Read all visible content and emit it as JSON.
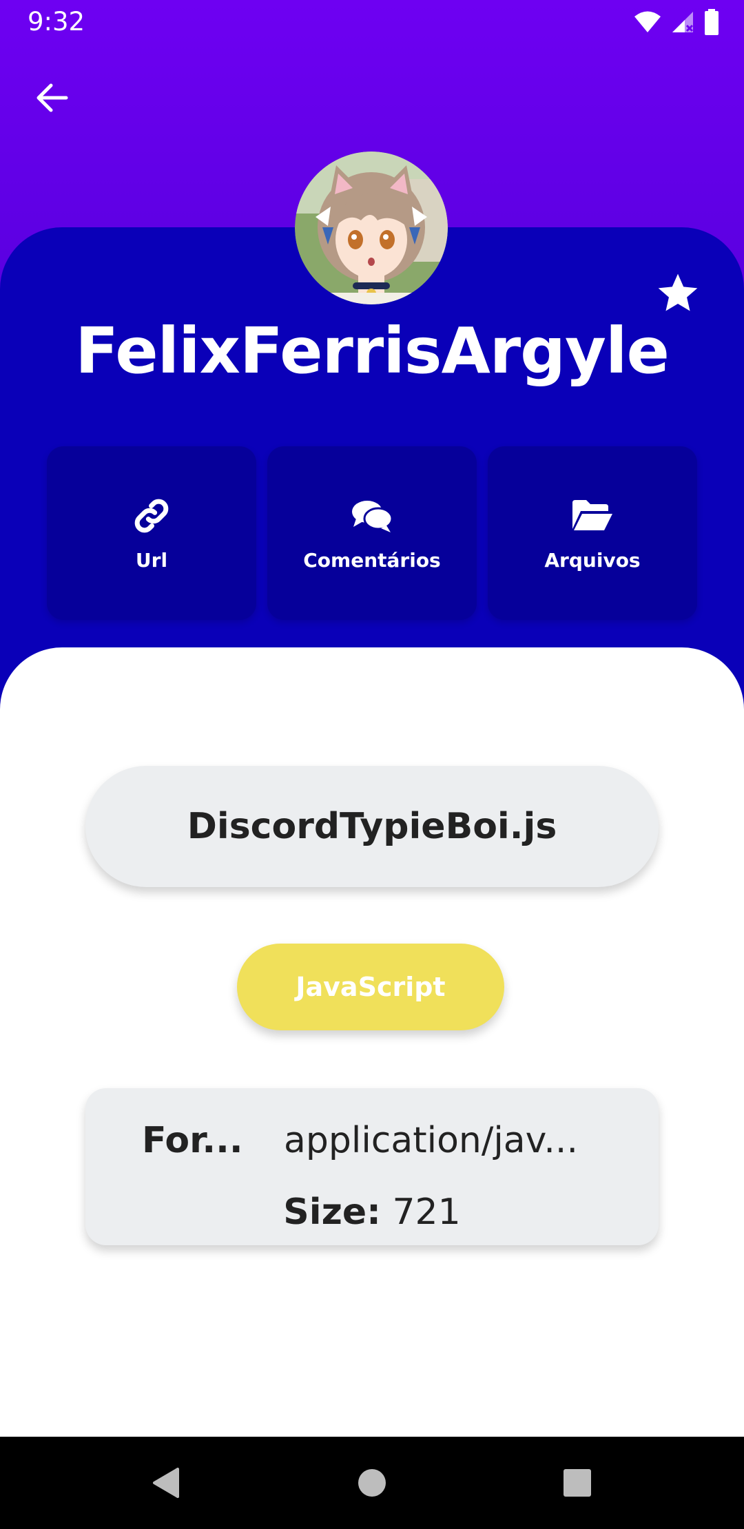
{
  "status_bar": {
    "time": "9:32"
  },
  "profile": {
    "username": "FelixFerrisArgyle"
  },
  "actions": [
    {
      "label": "Url",
      "icon": "link-icon"
    },
    {
      "label": "Comentários",
      "icon": "comments-icon"
    },
    {
      "label": "Arquivos",
      "icon": "folder-open-icon"
    }
  ],
  "file": {
    "name": "DiscordTypieBoi.js",
    "language": "JavaScript",
    "format_label": "For...",
    "format_value": "application/jav...",
    "size_label": "Size:",
    "size_value": "721"
  },
  "colors": {
    "top_purple": "#6e00f2",
    "header_blue": "#0a00b8",
    "action_card": "#06009a",
    "pill_grey": "#eceef0",
    "lang_yellow": "#f0e05a"
  }
}
